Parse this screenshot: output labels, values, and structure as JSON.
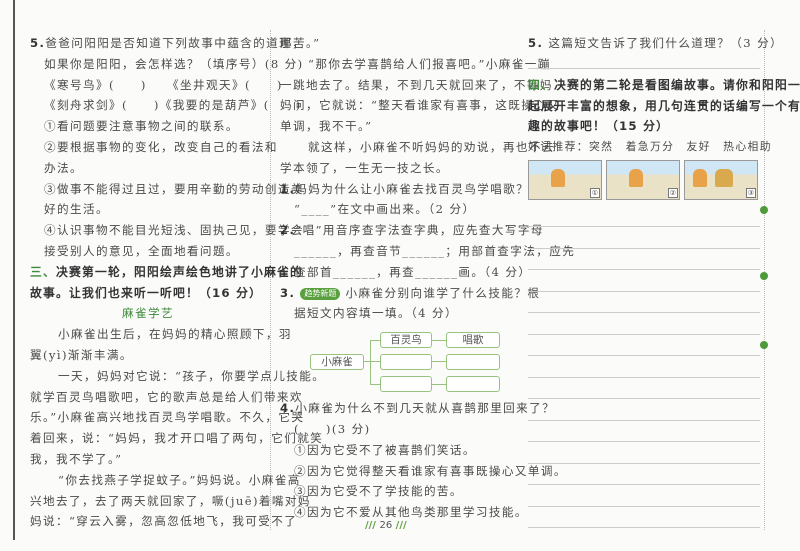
{
  "left": [
    {
      "c": "",
      "num": "5.",
      "text": "爸爸问阳阳是否知道下列故事中蕴含的道理，"
    },
    {
      "c": "in",
      "text": "如果你是阳阳，会怎样选？（填序号）(8 分)"
    },
    {
      "c": "in",
      "text": "《寒号鸟》(　　)　　《坐井观天》(　　)"
    },
    {
      "c": "in",
      "text": "《刻舟求剑》(　　)《我要的是葫芦》(　　)"
    },
    {
      "c": "in",
      "text": "①看问题要注意事物之间的联系。"
    },
    {
      "c": "in",
      "text": "②要根据事物的变化，改变自己的看法和"
    },
    {
      "c": "in",
      "text": "办法。"
    },
    {
      "c": "in",
      "text": "③做事不能得过且过，要用辛勤的劳动创造美"
    },
    {
      "c": "in",
      "text": "好的生活。"
    },
    {
      "c": "in",
      "text": "④认识事物不能目光短浅、固执己见，要学会"
    },
    {
      "c": "in",
      "text": "接受别人的意见，全面地看问题。"
    },
    {
      "c": "h",
      "num": "三、",
      "text": "决赛第一轮，阳阳绘声绘色地讲了小麻雀的"
    },
    {
      "c": "h",
      "text": "故事。让我们也来听一听吧！（16 分）"
    },
    {
      "c": "t",
      "text": "麻雀学艺"
    },
    {
      "c": "p",
      "text": "小麻雀出生后，在妈妈的精心照顾下，羽"
    },
    {
      "c": "",
      "text": "翼(yì)渐渐丰满。"
    },
    {
      "c": "p",
      "text": "一天，妈妈对它说：“孩子，你要学点儿技能。"
    },
    {
      "c": "",
      "text": "就学百灵鸟唱歌吧，它的歌声总是给人们带来欢"
    },
    {
      "c": "",
      "text": "乐。”小麻雀高兴地找百灵鸟学唱歌。不久，它哭"
    },
    {
      "c": "",
      "text": "着回来，说：“妈妈，我才开口唱了两句，它们就笑"
    },
    {
      "c": "",
      "text": "我，我不学了。”"
    },
    {
      "c": "p",
      "text": "“你去找燕子学捉蚊子。”妈妈说。小麻雀高"
    },
    {
      "c": "",
      "text": "兴地去了，去了两天就回家了，噘(juē)着嘴对妈"
    },
    {
      "c": "",
      "text": "妈说：“穿云入雾，忽高忽低地飞，我可受不了"
    }
  ],
  "middle_top": [
    {
      "c": "",
      "text": "那苦。”"
    },
    {
      "c": "p",
      "text": "“那你去学喜鹊给人们报喜吧。”小麻雀一蹦"
    },
    {
      "c": "",
      "text": "一跳地去了。结果，不到几天就回来了，不等妈"
    },
    {
      "c": "",
      "text": "妈问，它就说：“整天看谁家有喜事，这既操心又"
    },
    {
      "c": "",
      "text": "单调，我不干。”"
    },
    {
      "c": "p",
      "text": "就这样，小麻雀不听妈妈的劝说，再也不去"
    },
    {
      "c": "",
      "text": "学本领了，一生无一技之长。"
    },
    {
      "c": "",
      "num": "1.",
      "text": "妈妈为什么让小麻雀去找百灵鸟学唱歌？用"
    },
    {
      "c": "in",
      "text": "“____”在文中画出来。（2 分）"
    },
    {
      "c": "",
      "num": "2.",
      "text": "“唱”用音序查字法查字典，应先查大写字母"
    },
    {
      "c": "in",
      "text": "______，再查音节______；用部首查字法，应先"
    },
    {
      "c": "in",
      "text": "查部首______，再查______画。（4 分）"
    }
  ],
  "q3": {
    "num": "3.",
    "badge": "趋势新题",
    "line1": "小麻雀分别向谁学了什么技能？根",
    "line2": "据短文内容填一填。（4 分）"
  },
  "diagram": {
    "root": "小麻雀",
    "teacher1": "百灵鸟",
    "skill1": "唱歌",
    "teacher2": "",
    "skill2": "",
    "teacher3": "",
    "skill3": ""
  },
  "middle_bottom": [
    {
      "c": "",
      "num": "4.",
      "text": "小麻雀为什么不到几天就从喜鹊那里回来了？"
    },
    {
      "c": "in",
      "text": "(　　)(3 分)"
    },
    {
      "c": "in",
      "text": "①因为它受不了被喜鹊们笑话。"
    },
    {
      "c": "in",
      "text": "②因为它觉得整天看谁家有喜事既操心又单调。"
    },
    {
      "c": "in",
      "text": "③因为它受不了学技能的苦。"
    },
    {
      "c": "in",
      "text": "④因为它不爱从其他鸟类那里学习技能。"
    }
  ],
  "right": {
    "q5": {
      "num": "5.",
      "text": "这篇短文告诉了我们什么道理？（3 分）"
    },
    "section4": [
      {
        "num": "四、",
        "text": "决赛的第二轮是看图编故事。请你和阳阳一"
      },
      {
        "text": "起展开丰富的想象，用几句连贯的话编写一个有"
      },
      {
        "text": "趣的故事吧！（15 分）"
      }
    ],
    "words": "好词推荐：突然　着急万分　友好　热心相助",
    "pictures": [
      "①",
      "②",
      "③"
    ],
    "writing_lines": 15
  },
  "page_number": "26",
  "colors": {
    "accent": "#3f8a3a",
    "badge": "#5aa03f"
  }
}
